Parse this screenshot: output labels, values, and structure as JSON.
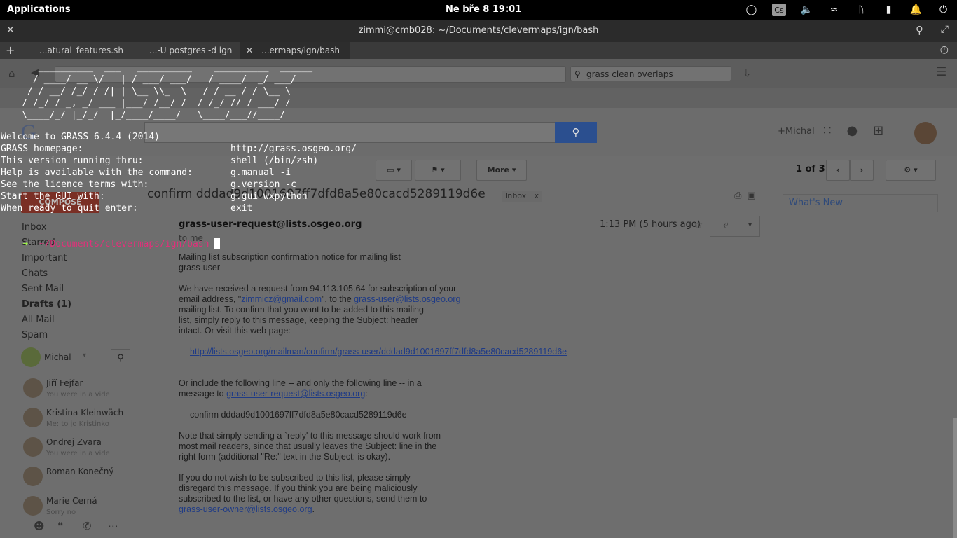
{
  "panel": {
    "applications": "Applications",
    "clock": "Ne bře  8   19:01",
    "lang": "Cs"
  },
  "window": {
    "title": "zimmi@cmb028: ~/Documents/clevermaps/ign/bash"
  },
  "tabs": [
    {
      "label": "...atural_features.sh"
    },
    {
      "label": "...-U postgres -d ign"
    },
    {
      "label": "...ermaps/ign/bash"
    }
  ],
  "terminal": {
    "banner": [
      "       __________  ___   __________    __________  ______",
      "      / ____/ __ \\/   | / ___/ ___/   / ____/  _/ ___/",
      "     / / __/ /_/ / /| | \\__ \\\\_  \\   / / __ / / \\__ \\",
      "    / /_/ / _, _/ ___ |___/ /__/ /  / /_/ // / ___/ /",
      "    \\____/_/ |_/_/  |_/____/____/   \\____/___//____/"
    ],
    "lines": [
      {
        "left": "Welcome to GRASS 6.4.4 (2014)",
        "right": ""
      },
      {
        "left": "GRASS homepage:",
        "right": "http://grass.osgeo.org/"
      },
      {
        "left": "This version running thru:",
        "right": "shell (/bin/zsh)"
      },
      {
        "left": "Help is available with the command:",
        "right": "g.manual -i"
      },
      {
        "left": "See the licence terms with:",
        "right": "g.version -c"
      },
      {
        "left": "Start the GUI with:",
        "right": "g.gui wxpython"
      },
      {
        "left": "When ready to quit enter:",
        "right": "exit"
      }
    ],
    "prompt_arrow": "➜",
    "prompt_path": "~/Documents/clevermaps/ign/bash"
  },
  "browser": {
    "search_value": "grass clean overlaps",
    "user": "+Michal",
    "more_label": "More",
    "pager": "1 of 3",
    "folders": [
      {
        "label": "Inbox",
        "bold": false
      },
      {
        "label": "Starred",
        "bold": false
      },
      {
        "label": "Important",
        "bold": false
      },
      {
        "label": "Chats",
        "bold": false
      },
      {
        "label": "Sent Mail",
        "bold": false
      },
      {
        "label": "Drafts (1)",
        "bold": true
      },
      {
        "label": "All Mail",
        "bold": false
      },
      {
        "label": "Spam",
        "bold": false
      }
    ],
    "chat_me": "Michal",
    "contacts": [
      {
        "name": "Jiří Fejfar",
        "status": "You were in a vide"
      },
      {
        "name": "Kristina Kleinwäch",
        "status": "Me: to jo Kristinko"
      },
      {
        "name": "Ondrej Zvara",
        "status": "You were in a vide"
      },
      {
        "name": "Roman Konečný",
        "status": ""
      },
      {
        "name": "Marie Cerná",
        "status": "Sorry no"
      }
    ],
    "email": {
      "subject": "confirm dddad9d1001697ff7dfd8a5e80cacd5289119d6e",
      "label": "Inbox",
      "sender": "grass-user-request@lists.osgeo.org",
      "to": "to me",
      "time": "1:13 PM (5 hours ago)",
      "p1": "Mailing list subscription confirmation notice for mailing list\ngrass-user",
      "p2a": "We have received a request from 94.113.105.64 for subscription of your\nemail address, \"",
      "p2_email": "zimmicz@gmail.com",
      "p2b": "\", to the ",
      "p2_list": "grass-user@lists.osgeo.org",
      "p2c": "\nmailing list.  To confirm that you want to be added to this mailing\nlist, simply reply to this message, keeping the Subject: header\nintact.  Or visit this web page:",
      "confirm_link": "http://lists.osgeo.org/mailman/confirm/grass-user/dddad9d1001697ff7dfd8a5e80cacd5289119d6e",
      "p3a": "Or include the following line -- and only the following line -- in a\nmessage to ",
      "p3_addr": "grass-user-request@lists.osgeo.org",
      "p3b": ":",
      "confirm_line": "confirm dddad9d1001697ff7dfd8a5e80cacd5289119d6e",
      "p4": "Note that simply sending a `reply' to this message should work from\nmost mail readers, since that usually leaves the Subject: line in the\nright form (additional \"Re:\" text in the Subject: is okay).",
      "p5": "If you do not wish to be subscribed to this list, please simply\ndisregard this message.  If you think you are being maliciously\nsubscribed to the list, or have any other questions, send them to",
      "owner": "grass-user-owner@lists.osgeo.org",
      "owner_suffix": "."
    },
    "whats_new": "What's New"
  }
}
